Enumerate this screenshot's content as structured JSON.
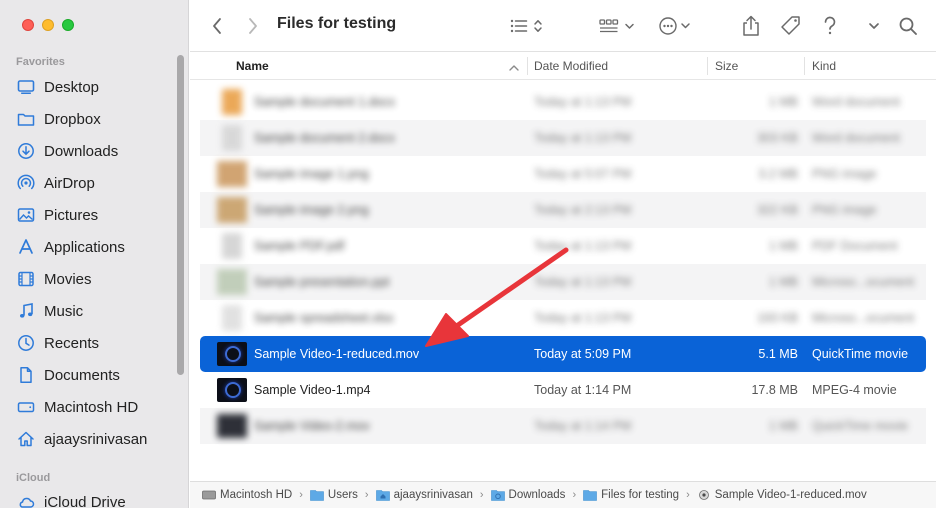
{
  "window": {
    "title": "Files for testing"
  },
  "sidebar": {
    "favorites_label": "Favorites",
    "icloud_label": "iCloud",
    "items": [
      {
        "label": "Desktop",
        "icon": "desktop-icon"
      },
      {
        "label": "Dropbox",
        "icon": "folder-icon"
      },
      {
        "label": "Downloads",
        "icon": "download-icon"
      },
      {
        "label": "AirDrop",
        "icon": "airdrop-icon"
      },
      {
        "label": "Pictures",
        "icon": "pictures-icon"
      },
      {
        "label": "Applications",
        "icon": "applications-icon"
      },
      {
        "label": "Movies",
        "icon": "movies-icon"
      },
      {
        "label": "Music",
        "icon": "music-icon"
      },
      {
        "label": "Recents",
        "icon": "clock-icon"
      },
      {
        "label": "Documents",
        "icon": "document-icon"
      },
      {
        "label": "Macintosh HD",
        "icon": "harddrive-icon"
      },
      {
        "label": "ajaaysrinivasan",
        "icon": "home-icon"
      }
    ],
    "icloud_items": [
      {
        "label": "iCloud Drive",
        "icon": "cloud-icon"
      }
    ]
  },
  "columns": {
    "name": "Name",
    "date": "Date Modified",
    "size": "Size",
    "kind": "Kind"
  },
  "files": [
    {
      "name": "Sample document 1.docx",
      "date": "Today at 1:13 PM",
      "size": "1 MB",
      "kind": "Word document",
      "blurred": true
    },
    {
      "name": "Sample document 2.docx",
      "date": "Today at 1:13 PM",
      "size": "303 KB",
      "kind": "Word document",
      "blurred": true
    },
    {
      "name": "Sample image 1.png",
      "date": "Today at 5:07 PM",
      "size": "3.2 MB",
      "kind": "PNG image",
      "blurred": true
    },
    {
      "name": "Sample image 2.png",
      "date": "Today at 2:13 PM",
      "size": "322 KB",
      "kind": "PNG image",
      "blurred": true
    },
    {
      "name": "Sample PDF.pdf",
      "date": "Today at 1:13 PM",
      "size": "1 MB",
      "kind": "PDF Document",
      "blurred": true
    },
    {
      "name": "Sample presentation.ppt",
      "date": "Today at 1:13 PM",
      "size": "1 MB",
      "kind": "Microso...ocument",
      "blurred": true
    },
    {
      "name": "Sample spreadsheet.xlsx",
      "date": "Today at 1:13 PM",
      "size": "193 KB",
      "kind": "Microso...ocument",
      "blurred": true
    },
    {
      "name": "Sample Video-1-reduced.mov",
      "date": "Today at 5:09 PM",
      "size": "5.1 MB",
      "kind": "QuickTime movie",
      "selected": true
    },
    {
      "name": "Sample Video-1.mp4",
      "date": "Today at 1:14 PM",
      "size": "17.8 MB",
      "kind": "MPEG-4 movie"
    },
    {
      "name": "Sample Video-2.mov",
      "date": "Today at 1:14 PM",
      "size": "1 MB",
      "kind": "QuickTime movie",
      "blurred": true
    }
  ],
  "path": [
    {
      "label": "Macintosh HD",
      "icon": "harddrive-icon"
    },
    {
      "label": "Users",
      "icon": "folder-icon"
    },
    {
      "label": "ajaaysrinivasan",
      "icon": "home-folder-icon"
    },
    {
      "label": "Downloads",
      "icon": "downloads-folder-icon"
    },
    {
      "label": "Files for testing",
      "icon": "folder-icon"
    },
    {
      "label": "Sample Video-1-reduced.mov",
      "icon": "quicktime-icon"
    }
  ],
  "path_separator": "›",
  "colors": {
    "accent": "#0a63d7",
    "annotation_arrow": "#e8353a",
    "sidebar_icon": "#2f7bd9"
  }
}
